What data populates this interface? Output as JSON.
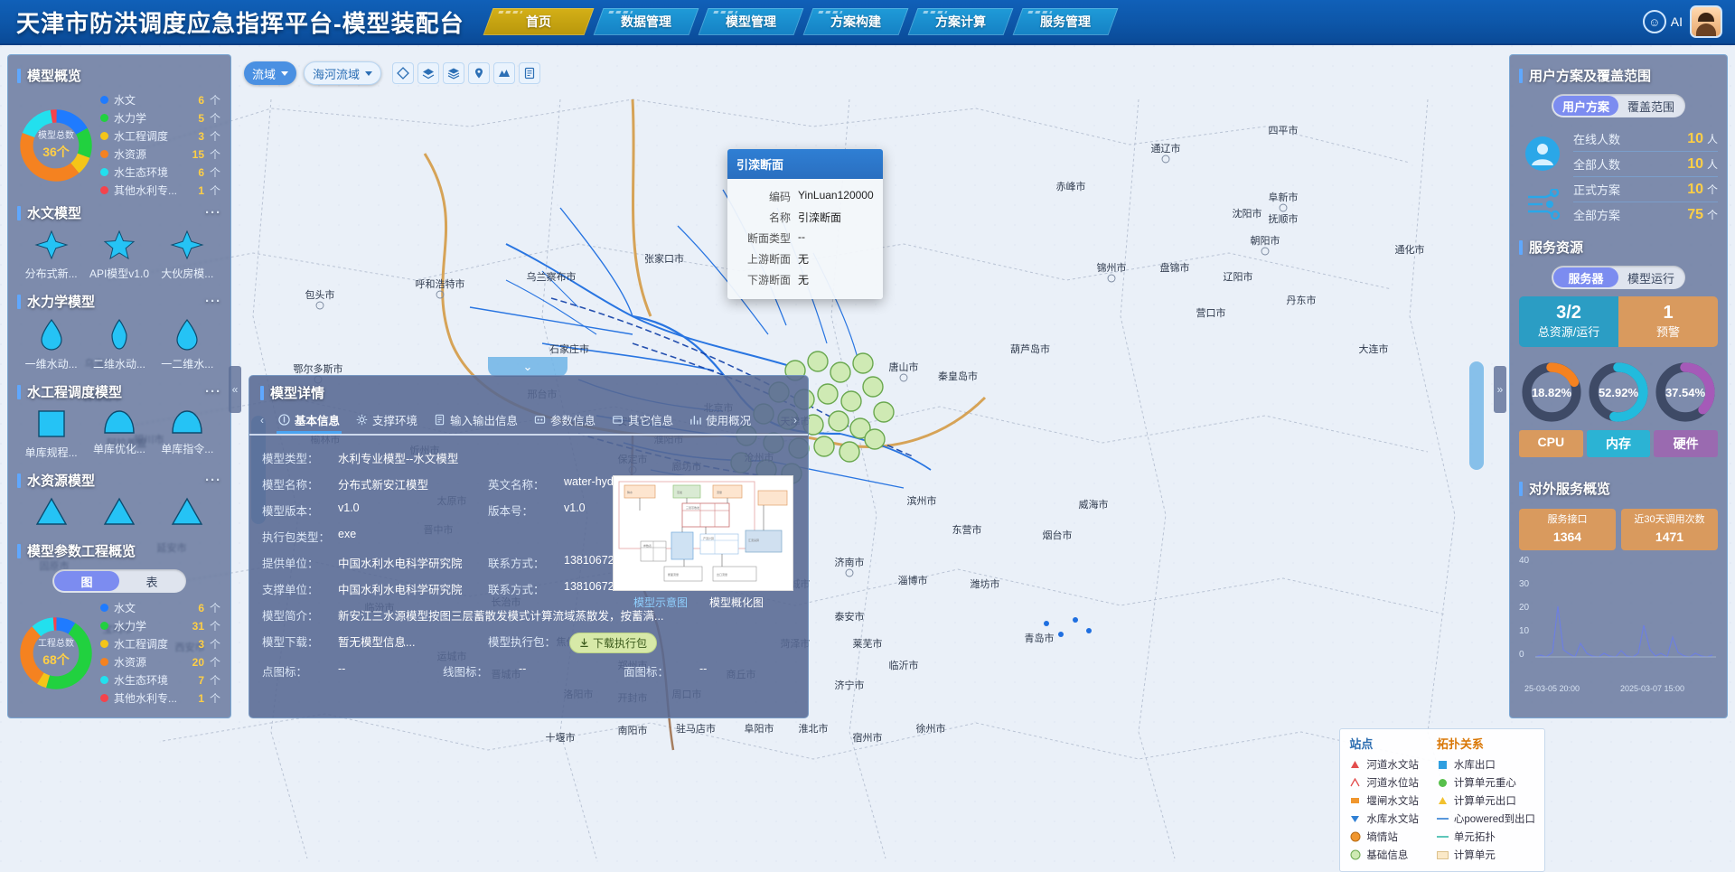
{
  "header": {
    "title": "天津市防洪调度应急指挥平台-模型装配台",
    "tabs": [
      {
        "label": "首页",
        "active": true
      },
      {
        "label": "数据管理",
        "active": false
      },
      {
        "label": "模型管理",
        "active": false
      },
      {
        "label": "方案构建",
        "active": false
      },
      {
        "label": "方案计算",
        "active": false
      },
      {
        "label": "服务管理",
        "active": false
      }
    ],
    "ai_label": "AI",
    "ai_icon": "smiley-icon",
    "avatar_icon": "user-avatar"
  },
  "map_toolbar": {
    "scope_select": "流域",
    "basin_select": "海河流域",
    "tools": [
      "diamond-layer-icon",
      "layers-icon",
      "stack-icon",
      "marker-icon",
      "terrain-icon",
      "list-icon"
    ]
  },
  "left_panel": {
    "overview": {
      "title": "模型概览",
      "center_label": "模型总数",
      "center_value": "36个",
      "legend": [
        {
          "name": "水文",
          "value": "6",
          "unit": "个",
          "color": "#1f7bff"
        },
        {
          "name": "水力学",
          "value": "5",
          "unit": "个",
          "color": "#21d13f"
        },
        {
          "name": "水工程调度",
          "value": "3",
          "unit": "个",
          "color": "#f5c518"
        },
        {
          "name": "水资源",
          "value": "15",
          "unit": "个",
          "color": "#f58220"
        },
        {
          "name": "水生态环境",
          "value": "6",
          "unit": "个",
          "color": "#22e0ee"
        },
        {
          "name": "其他水利专...",
          "value": "1",
          "unit": "个",
          "color": "#f5434c"
        }
      ]
    },
    "groups": [
      {
        "title": "水文模型",
        "items": [
          {
            "label": "分布式新...",
            "icon": "four-point-star-icon"
          },
          {
            "label": "API模型v1.0",
            "icon": "five-point-star-icon"
          },
          {
            "label": "大伙房模...",
            "icon": "four-point-star-icon"
          }
        ]
      },
      {
        "title": "水力学模型",
        "items": [
          {
            "label": "一维水动...",
            "icon": "droplet-icon"
          },
          {
            "label": "二维水动...",
            "icon": "lens-icon"
          },
          {
            "label": "一二维水...",
            "icon": "droplet-icon"
          }
        ]
      },
      {
        "title": "水工程调度模型",
        "items": [
          {
            "label": "单库规程...",
            "icon": "square-icon"
          },
          {
            "label": "单库优化...",
            "icon": "dome-icon"
          },
          {
            "label": "单库指令...",
            "icon": "dome-icon"
          }
        ]
      },
      {
        "title": "水资源模型",
        "items": [
          {
            "label": "",
            "icon": "triangle-icon"
          },
          {
            "label": "",
            "icon": "triangle-icon"
          },
          {
            "label": "",
            "icon": "triangle-icon"
          }
        ]
      }
    ],
    "param_overview": {
      "title": "模型参数工程概览",
      "toggle": [
        {
          "label": "图",
          "active": true
        },
        {
          "label": "表",
          "active": false
        }
      ],
      "center_label": "工程总数",
      "center_value": "68个",
      "legend": [
        {
          "name": "水文",
          "value": "6",
          "unit": "个",
          "color": "#1f7bff"
        },
        {
          "name": "水力学",
          "value": "31",
          "unit": "个",
          "color": "#21d13f"
        },
        {
          "name": "水工程调度",
          "value": "3",
          "unit": "个",
          "color": "#f5c518"
        },
        {
          "name": "水资源",
          "value": "20",
          "unit": "个",
          "color": "#f58220"
        },
        {
          "name": "水生态环境",
          "value": "7",
          "unit": "个",
          "color": "#22e0ee"
        },
        {
          "name": "其他水利专...",
          "value": "1",
          "unit": "个",
          "color": "#f5434c"
        }
      ]
    }
  },
  "right_panel": {
    "user_plan": {
      "title": "用户方案及覆盖范围",
      "toggle": [
        {
          "label": "用户方案",
          "active": true
        },
        {
          "label": "覆盖范围",
          "active": false
        }
      ],
      "icons": [
        "user-circle-icon",
        "network-nodes-icon"
      ],
      "rows": [
        {
          "key": "在线人数",
          "value": "10",
          "unit": "人"
        },
        {
          "key": "全部人数",
          "value": "10",
          "unit": "人"
        },
        {
          "key": "正式方案",
          "value": "10",
          "unit": "个"
        },
        {
          "key": "全部方案",
          "value": "75",
          "unit": "个"
        }
      ]
    },
    "service_resource": {
      "title": "服务资源",
      "toggle": [
        {
          "label": "服务器",
          "active": true
        },
        {
          "label": "模型运行",
          "active": false
        }
      ],
      "stats": [
        {
          "value": "3/2",
          "label": "总资源/运行",
          "color": "#2b9dc4"
        },
        {
          "value": "1",
          "label": "预警",
          "color": "#d99a5e"
        }
      ],
      "gauges": [
        {
          "label": "CPU",
          "value": "18.82%",
          "percent": 18.82,
          "color": "#f58220"
        },
        {
          "label": "内存",
          "value": "52.92%",
          "percent": 52.92,
          "color": "#22bbdd"
        },
        {
          "label": "硬件",
          "value": "37.54%",
          "percent": 37.54,
          "color": "#a55ab8"
        }
      ]
    },
    "external_service": {
      "title": "对外服务概览",
      "badges": [
        {
          "label": "服务接口",
          "value": "1364",
          "color": "#d99a5e"
        },
        {
          "label": "近30天调用次数",
          "value": "1471",
          "color": "#d99a5e"
        }
      ],
      "chart_axis_y": [
        "40",
        "30",
        "20",
        "10",
        "0"
      ],
      "chart_axis_x": [
        "25-03-05 20:00",
        "2025-03-07 15:00"
      ]
    }
  },
  "feature_popup": {
    "title": "引滦断面",
    "rows": [
      {
        "key": "编码",
        "value": "YinLuan120000"
      },
      {
        "key": "名称",
        "value": "引滦断面"
      },
      {
        "key": "断面类型",
        "value": "--"
      },
      {
        "key": "上游断面",
        "value": "无"
      },
      {
        "key": "下游断面",
        "value": "无"
      }
    ]
  },
  "model_detail": {
    "title": "模型详情",
    "tabs": [
      {
        "label": "基本信息",
        "icon": "info-icon",
        "active": true
      },
      {
        "label": "支撑环境",
        "icon": "gear-icon",
        "active": false
      },
      {
        "label": "输入输出信息",
        "icon": "doc-icon",
        "active": false
      },
      {
        "label": "参数信息",
        "icon": "sliders-icon",
        "active": false
      },
      {
        "label": "其它信息",
        "icon": "box-icon",
        "active": false
      },
      {
        "label": "使用概况",
        "icon": "chart-icon",
        "active": false
      }
    ],
    "fields": [
      [
        {
          "key": "模型类型：",
          "value": "水利专业模型--水文模型"
        }
      ],
      [
        {
          "key": "模型名称：",
          "value": "分布式新安江模型"
        },
        {
          "key": "英文名称：",
          "value": "water-hydro-fbsxaj"
        }
      ],
      [
        {
          "key": "模型版本：",
          "value": "v1.0"
        },
        {
          "key": "版本号：",
          "value": "v1.0"
        }
      ],
      [
        {
          "key": "执行包类型：",
          "value": "exe"
        }
      ],
      [
        {
          "key": "提供单位：",
          "value": "中国水利水电科学研究院"
        },
        {
          "key": "联系方式：",
          "value": "13810672475"
        }
      ],
      [
        {
          "key": "支撑单位：",
          "value": "中国水利水电科学研究院"
        },
        {
          "key": "联系方式：",
          "value": "13810672475"
        }
      ],
      [
        {
          "key": "模型简介：",
          "value": "新安江三水源模型按图三层蓄散发模式计算流域蒸散发，按蓄满..."
        }
      ]
    ],
    "download_row": {
      "key": "模型下载：",
      "value": "暂无模型信息...",
      "pkg_key": "模型执行包：",
      "btn": "下载执行包",
      "btn_icon": "download-icon"
    },
    "icon_row": [
      {
        "key": "点图标：",
        "value": "--"
      },
      {
        "key": "线图标：",
        "value": "--"
      },
      {
        "key": "面图标：",
        "value": "--"
      }
    ],
    "thumb_captions": [
      {
        "label": "模型示意图",
        "color": "#8fd0ff"
      },
      {
        "label": "模型概化图",
        "color": "#ffffff"
      }
    ]
  },
  "map_legend": {
    "site": {
      "title": "站点",
      "items": [
        {
          "label": "河道水文站",
          "symbol": "triangle-red"
        },
        {
          "label": "河道水位站",
          "symbol": "stage-red"
        },
        {
          "label": "堰闸水文站",
          "symbol": "weir-orange"
        },
        {
          "label": "水库水文站",
          "symbol": "reservoir-blue"
        },
        {
          "label": "墒情站",
          "symbol": "soil-orange"
        },
        {
          "label": "基础信息",
          "symbol": "base-green"
        }
      ]
    },
    "topology": {
      "title": "拓扑关系",
      "items": [
        {
          "label": "水库出口",
          "symbol": "square-blue"
        },
        {
          "label": "计算单元重心",
          "symbol": "circle-green"
        },
        {
          "label": "计算单元出口",
          "symbol": "triangle-yellow"
        },
        {
          "label": "心powered到出口",
          "symbol": "line-blue"
        },
        {
          "label": "单元拓扑",
          "symbol": "line-teal"
        },
        {
          "label": "计算单元",
          "symbol": "rect-cream"
        }
      ]
    }
  },
  "chart_data": {
    "type": "line",
    "title": "近30天调用次数",
    "x": [
      "25-03-05 20:00",
      "2025-03-07 15:00"
    ],
    "ylim": [
      0,
      40
    ],
    "yticks": [
      0,
      10,
      20,
      30,
      40
    ],
    "series": [
      {
        "name": "调用次数",
        "values": [
          1,
          2,
          1,
          3,
          22,
          4,
          2,
          1,
          6,
          2,
          1,
          1,
          2,
          1,
          1,
          3,
          1,
          1,
          2,
          14,
          3,
          1,
          2,
          1,
          8,
          2,
          1,
          1,
          2,
          1
        ]
      }
    ],
    "grid": false,
    "legend": "none"
  }
}
